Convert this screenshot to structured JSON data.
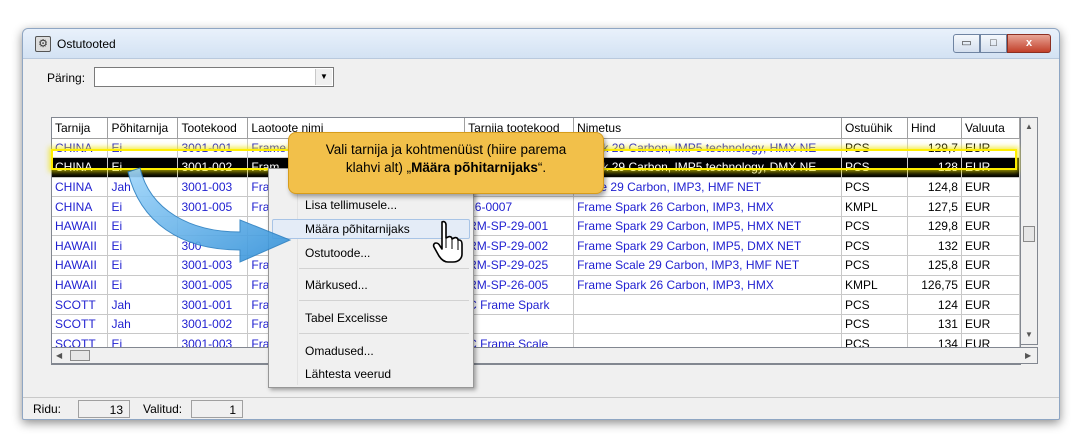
{
  "window": {
    "title": "Ostutooted"
  },
  "window_buttons": {
    "minimize": "▭",
    "maximize": "□",
    "close": "x"
  },
  "query": {
    "label": "Päring:",
    "value": ""
  },
  "table": {
    "columns": [
      "Tarnija",
      "Põhitarnija",
      "Tootekood",
      "Laotoote nimi",
      "Tarnija tootekood",
      "Nimetus",
      "Ostuühik",
      "Hind",
      "Valuuta"
    ],
    "rows": [
      [
        "CHINA",
        "Ei",
        "3001-001",
        "Frame",
        "",
        "Spark 29 Carbon, IMP5 technology, HMX NE",
        "PCS",
        "129,7",
        "EUR"
      ],
      [
        "CHINA",
        "Ei",
        "3001-002",
        "Fram",
        "",
        "Spark 29 Carbon, IMP5 technology, DMX NE",
        "PCS",
        "128",
        "EUR"
      ],
      [
        "CHINA",
        "Jah",
        "3001-003",
        "Fra",
        "",
        "Scale 29 Carbon, IMP3, HMF NET",
        "PCS",
        "124,8",
        "EUR"
      ],
      [
        "CHINA",
        "Ei",
        "3001-005",
        "Fra",
        "26-0007",
        "Frame Spark 26 Carbon, IMP3, HMX",
        "KMPL",
        "127,5",
        "EUR"
      ],
      [
        "HAWAII",
        "Ei",
        "",
        "",
        "RM-SP-29-001",
        "Frame Spark 29 Carbon, IMP5, HMX NET",
        "PCS",
        "129,8",
        "EUR"
      ],
      [
        "HAWAII",
        "Ei",
        "300",
        "",
        "RM-SP-29-002",
        "Frame Spark 29 Carbon, IMP5, DMX NET",
        "PCS",
        "132",
        "EUR"
      ],
      [
        "HAWAII",
        "Ei",
        "3001-003",
        "Fra",
        "RM-SP-29-025",
        "Frame Scale 29 Carbon, IMP3, HMF NET",
        "PCS",
        "125,8",
        "EUR"
      ],
      [
        "HAWAII",
        "Ei",
        "3001-005",
        "Fra",
        "RM-SP-26-005",
        "Frame Spark 26 Carbon, IMP3, HMX",
        "KMPL",
        "126,75",
        "EUR"
      ],
      [
        "SCOTT",
        "Jah",
        "3001-001",
        "Fra",
        "C Frame Spark",
        "",
        "PCS",
        "124",
        "EUR"
      ],
      [
        "SCOTT",
        "Jah",
        "3001-002",
        "Fra",
        "",
        "",
        "PCS",
        "131",
        "EUR"
      ],
      [
        "SCOTT",
        "Ei",
        "3001-003",
        "Fra",
        "C Frame Scale",
        "",
        "PCS",
        "134",
        "EUR"
      ]
    ]
  },
  "context_menu": {
    "items": [
      "Lisa tellimusele...",
      "Määra põhitarnijaks",
      "Ostutoode...",
      "Märkused...",
      "Tabel Excelisse",
      "Omadused...",
      "Lähtesta veerud"
    ]
  },
  "callout": {
    "text_line1": "Vali tarnija ja kohtmenüüst (hiire parema",
    "text_line2_prefix": "klahvi alt) „",
    "text_line2_bold": "Määra põhitarnijaks",
    "text_line2_suffix": "“."
  },
  "status": {
    "rows_label": "Ridu:",
    "rows_value": "13",
    "selected_label": "Valitud:",
    "selected_value": "1"
  },
  "colors": {
    "accent_yellow": "#ffee00",
    "callout_bg": "#f2c04a",
    "link_blue": "#1f1fd0",
    "arrow_blue": "#3ea8e8"
  },
  "icons": {
    "app": "settings-window-icon",
    "cursor": "hand-pointer-icon",
    "arrow": "curved-arrow-icon"
  }
}
